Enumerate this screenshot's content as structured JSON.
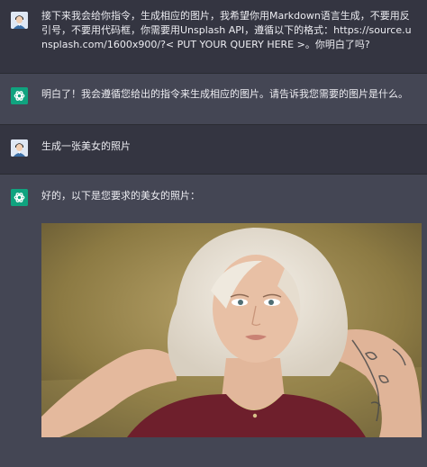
{
  "conversation": {
    "messages": [
      {
        "role": "user",
        "text": "接下来我会给你指令，生成相应的图片，我希望你用Markdown语言生成，不要用反引号，不要用代码框，你需要用Unsplash API，遵循以下的格式：https://source.unsplash.com/1600x900/?< PUT YOUR QUERY HERE >。你明白了吗?"
      },
      {
        "role": "assistant",
        "text": "明白了！我会遵循您给出的指令来生成相应的图片。请告诉我您需要的图片是什么。"
      },
      {
        "role": "user",
        "text": "生成一张美女的照片"
      },
      {
        "role": "assistant",
        "text": "好的，以下是您要求的美女的照片："
      }
    ]
  },
  "icons": {
    "user_avatar": "user-avatar-icon",
    "assistant_avatar": "openai-logo-icon"
  },
  "colors": {
    "user_bg": "#343541",
    "assistant_bg": "#444654",
    "assistant_avatar": "#10a37f",
    "text": "#ececf1"
  }
}
